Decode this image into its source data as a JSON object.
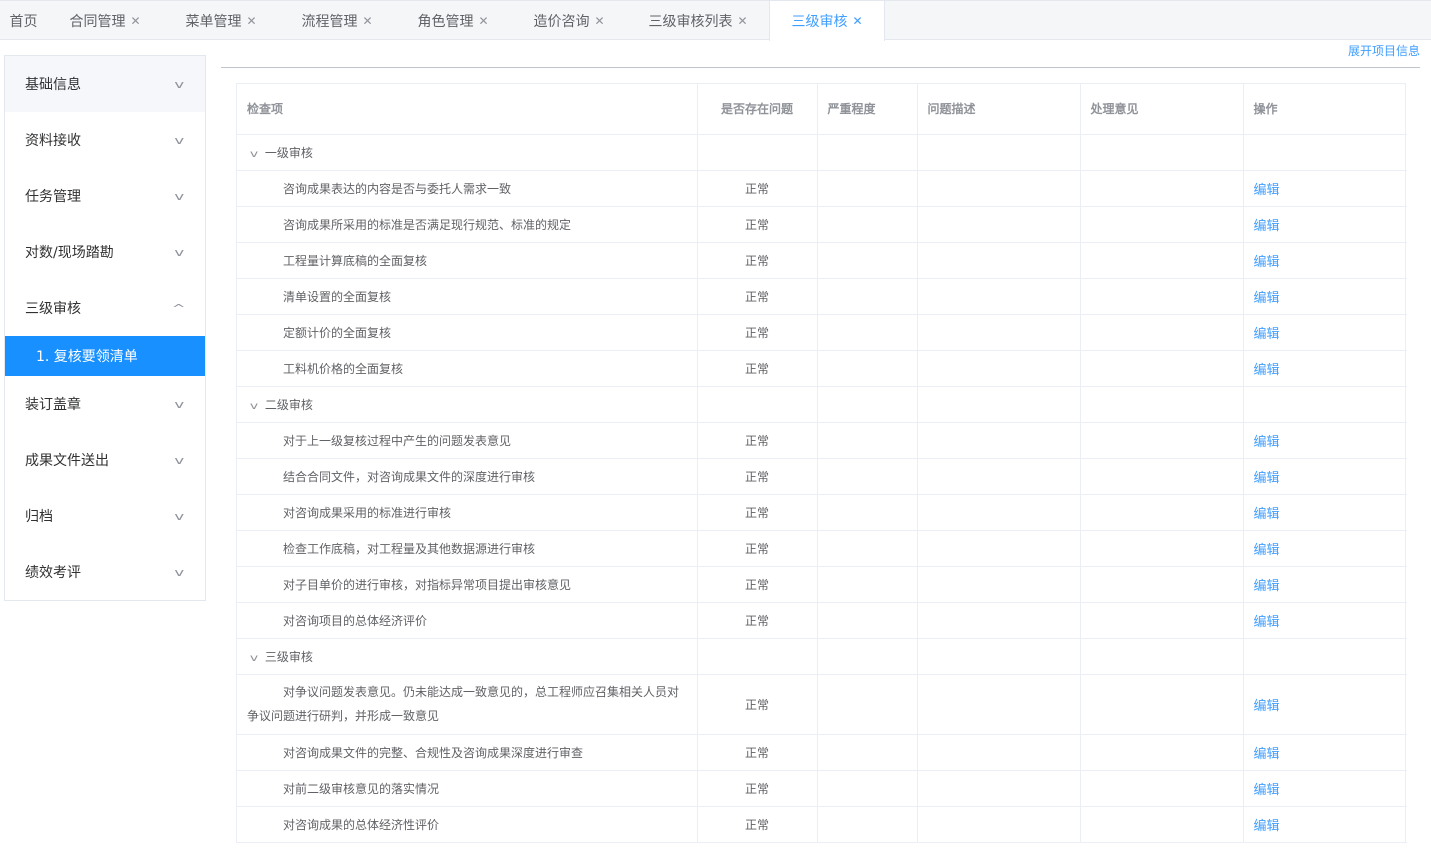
{
  "tabs": [
    {
      "label": "首页",
      "closable": false,
      "active": false
    },
    {
      "label": "合同管理",
      "closable": true,
      "active": false
    },
    {
      "label": "菜单管理",
      "closable": true,
      "active": false
    },
    {
      "label": "流程管理",
      "closable": true,
      "active": false
    },
    {
      "label": "角色管理",
      "closable": true,
      "active": false
    },
    {
      "label": "造价咨询",
      "closable": true,
      "active": false
    },
    {
      "label": "三级审核列表",
      "closable": true,
      "active": false
    },
    {
      "label": "三级审核",
      "closable": true,
      "active": true
    }
  ],
  "tab_close_glyph": "✕",
  "expand_link": "展开项目信息",
  "sidebar": {
    "items": [
      {
        "label": "基础信息",
        "expanded": false
      },
      {
        "label": "资料接收",
        "expanded": false
      },
      {
        "label": "任务管理",
        "expanded": false
      },
      {
        "label": "对数/现场踏勘",
        "expanded": false
      },
      {
        "label": "三级审核",
        "expanded": true,
        "children": [
          {
            "label": "1. 复核要领清单",
            "active": true
          }
        ]
      },
      {
        "label": "装订盖章",
        "expanded": false
      },
      {
        "label": "成果文件送出",
        "expanded": false
      },
      {
        "label": "归档",
        "expanded": false
      },
      {
        "label": "绩效考评",
        "expanded": false
      }
    ]
  },
  "table": {
    "columns": [
      "检查项",
      "是否存在问题",
      "严重程度",
      "问题描述",
      "处理意见",
      "操作"
    ],
    "edit_label": "编辑",
    "groups": [
      {
        "title": "一级审核",
        "rows": [
          {
            "item": "咨询成果表达的内容是否与委托人需求一致",
            "status": "正常"
          },
          {
            "item": "咨询成果所采用的标准是否满足现行规范、标准的规定",
            "status": "正常"
          },
          {
            "item": "工程量计算底稿的全面复核",
            "status": "正常"
          },
          {
            "item": "清单设置的全面复核",
            "status": "正常"
          },
          {
            "item": "定额计价的全面复核",
            "status": "正常"
          },
          {
            "item": "工料机价格的全面复核",
            "status": "正常"
          }
        ]
      },
      {
        "title": "二级审核",
        "rows": [
          {
            "item": "对于上一级复核过程中产生的问题发表意见",
            "status": "正常"
          },
          {
            "item": "结合合同文件，对咨询成果文件的深度进行审核",
            "status": "正常"
          },
          {
            "item": "对咨询成果采用的标准进行审核",
            "status": "正常"
          },
          {
            "item": "检查工作底稿，对工程量及其他数据源进行审核",
            "status": "正常"
          },
          {
            "item": "对子目单价的进行审核，对指标异常项目提出审核意见",
            "status": "正常"
          },
          {
            "item": "对咨询项目的总体经济评价",
            "status": "正常"
          }
        ]
      },
      {
        "title": "三级审核",
        "rows": [
          {
            "item": "对争议问题发表意见。仍未能达成一致意见的，总工程师应召集相关人员对争议问题进行研判，并形成一致意见",
            "status": "正常",
            "tall": true
          },
          {
            "item": "对咨询成果文件的完整、合规性及咨询成果深度进行审查",
            "status": "正常"
          },
          {
            "item": "对前二级审核意见的落实情况",
            "status": "正常"
          },
          {
            "item": "对咨询成果的总体经济性评价",
            "status": "正常"
          }
        ]
      }
    ]
  },
  "colors": {
    "accent": "#409eff",
    "active_menu_bg": "#1890ff"
  }
}
